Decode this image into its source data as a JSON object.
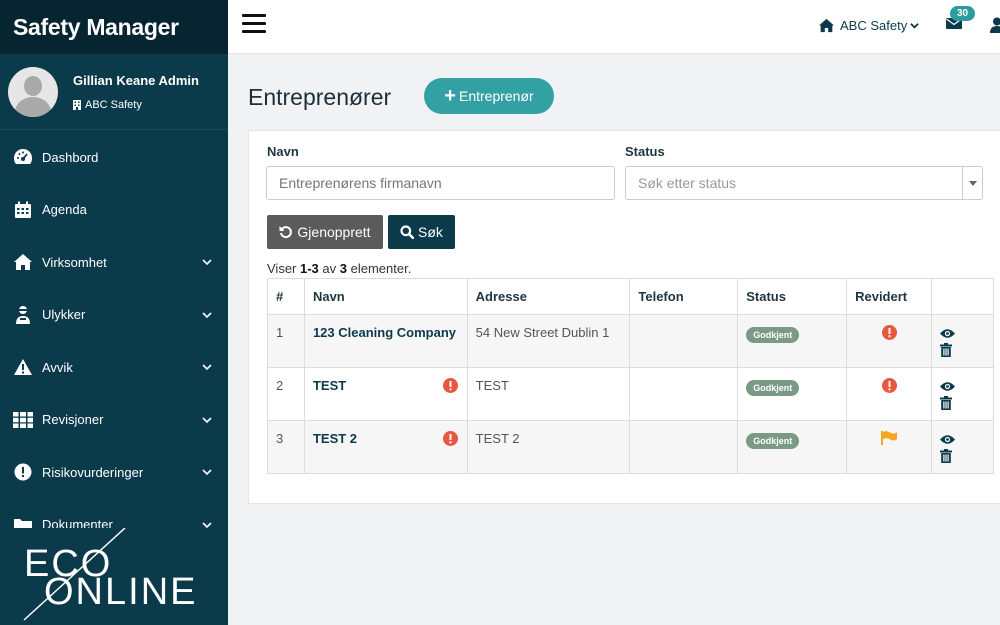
{
  "app": {
    "title": "Safety Manager"
  },
  "profile": {
    "name": "Gillian Keane Admin",
    "org": "ABC Safety"
  },
  "sidebar": {
    "items": [
      {
        "label": "Dashbord",
        "icon": "dashboard-icon",
        "expandable": false
      },
      {
        "label": "Agenda",
        "icon": "calendar-icon",
        "expandable": false
      },
      {
        "label": "Virksomhet",
        "icon": "home-icon",
        "expandable": true
      },
      {
        "label": "Ulykker",
        "icon": "injured-person-icon",
        "expandable": true
      },
      {
        "label": "Avvik",
        "icon": "warning-icon",
        "expandable": true
      },
      {
        "label": "Revisjoner",
        "icon": "grid-icon",
        "expandable": true
      },
      {
        "label": "Risikovurderinger",
        "icon": "alert-circle-icon",
        "expandable": true
      },
      {
        "label": "Dokumenter",
        "icon": "folder-icon",
        "expandable": true
      }
    ]
  },
  "logo": {
    "text_top": "ECO",
    "text_bottom": "ONLINE"
  },
  "topbar": {
    "org_label": "ABC Safety",
    "mail_count": "30"
  },
  "page": {
    "title": "Entreprenører",
    "add_button": "Entreprenør"
  },
  "filters": {
    "name_label": "Navn",
    "name_placeholder": "Entreprenørens firmanavn",
    "status_label": "Status",
    "status_placeholder": "Søk etter status",
    "reset_button": "Gjenopprett",
    "search_button": "Søk"
  },
  "summary": {
    "prefix": "Viser ",
    "range": "1-3",
    "middle": " av ",
    "total": "3",
    "suffix": " elementer."
  },
  "table": {
    "headers": [
      "#",
      "Navn",
      "Adresse",
      "Telefon",
      "Status",
      "Revidert",
      ""
    ],
    "rows": [
      {
        "index": "1",
        "name": "123 Cleaning Company",
        "name_warning": false,
        "address": "54 New Street Dublin 1",
        "phone": "",
        "status": "Godkjent",
        "revised": "alert"
      },
      {
        "index": "2",
        "name": "TEST",
        "name_warning": true,
        "address": "TEST",
        "phone": "",
        "status": "Godkjent",
        "revised": "alert"
      },
      {
        "index": "3",
        "name": "TEST 2",
        "name_warning": true,
        "address": "TEST 2",
        "phone": "",
        "status": "Godkjent",
        "revised": "flag"
      }
    ]
  },
  "colors": {
    "sidebar": "#0b3a4b",
    "brand_bar": "#062530",
    "accent": "#33a1a4",
    "alert": "#e8573f",
    "flag": "#f5a623",
    "status_pill": "#7a9a86"
  }
}
